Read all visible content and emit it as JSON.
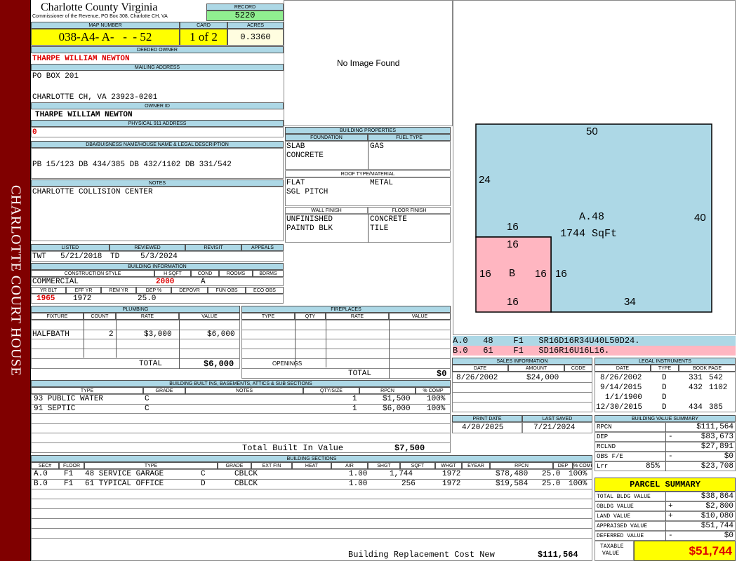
{
  "sidebar": {
    "title": "CHARLOTTE COURT HOUSE"
  },
  "header": {
    "county": "Charlotte County Virginia",
    "commissioner": "Commissioner of the Revenue, PO Box 308, Charlotte CH, VA",
    "record_label": "RECORD",
    "record": "5220",
    "map_label": "MAP NUMBER",
    "map_number": "038-A4- A-   -  - 52",
    "card_label": "CARD",
    "card": "1 of 2",
    "acres_label": "ACRES",
    "acres": "0.3360"
  },
  "owner": {
    "deeded_label": "DEEDED OWNER",
    "deeded": "THARPE WILLIAM NEWTON",
    "mailing_label": "MAILING ADDRESS",
    "mail1": "PO BOX 201",
    "mail2": "CHARLOTTE CH, VA 23923-0201",
    "owner_id_label": "OWNER ID",
    "owner_id": "THARPE WILLIAM NEWTON",
    "phys_label": "PHYSICAL 911 ADDRESS",
    "phys": "0",
    "dba_label": "DBA/BUISNESS NAME/HOUSE NAME & LEGAL DESCRIPTION",
    "dba": "PB 15/123 DB 434/385 DB 432/1102 DB 331/542",
    "notes_label": "NOTES",
    "notes": "CHARLOTTE COLLISION CENTER"
  },
  "image": {
    "text": "No Image Found"
  },
  "bldg_props": {
    "title": "BUILDING PROPERTIES",
    "foundation_label": "FOUNDATION",
    "fuel_label": "FUEL TYPE",
    "foundation1": "SLAB",
    "foundation2": "CONCRETE",
    "fuel": "GAS",
    "roof_label": "ROOF TYPE/MATERIAL",
    "roof1": "FLAT",
    "roof2": "SGL PITCH",
    "roof_mat": "METAL",
    "wall_label": "WALL FINISH",
    "floor_label": "FLOOR FINISH",
    "wall1": "UNFINISHED",
    "wall2": "PAINTD BLK",
    "floor1": "CONCRETE",
    "floor2": "TILE"
  },
  "listing": {
    "listed_label": "LISTED",
    "reviewed_label": "REVIEWED",
    "revisit_label": "REVISIT",
    "appeals_label": "APPEALS",
    "listed_by": "TWT",
    "listed_date": "5/21/2018",
    "reviewed_by": "TD",
    "reviewed_date": "5/3/2024"
  },
  "bldg_info": {
    "title": "BUILDING INFORMATION",
    "h_style": "CONSTRUCTION STYLE",
    "h_hsqft": "H SQFT",
    "h_cond": "COND",
    "h_rooms": "ROOMS",
    "h_bdrms": "BDRMS",
    "style": "COMMERCIAL",
    "hsqft": "2000",
    "cond": "A",
    "h_yrblt": "YR BLT",
    "h_effyr": "EFF YR",
    "h_remyr": "REM YR",
    "h_dep": "DEP %",
    "h_depovr": "DEPOVR",
    "h_funobs": "FUN OBS",
    "h_ecoobs": "ECO OBS",
    "yrblt": "1965",
    "effyr": "1972",
    "dep": "25.0"
  },
  "plumbing": {
    "title": "PLUMBING",
    "h_fixture": "FIXTURE",
    "h_count": "COUNT",
    "h_rate": "RATE",
    "h_value": "VALUE",
    "rows": [
      {
        "fixture": "HALFBATH",
        "count": "2",
        "rate": "$3,000",
        "value": "$6,000"
      }
    ],
    "total_label": "TOTAL",
    "total": "$6,000"
  },
  "fireplaces": {
    "title": "FIREPLACES",
    "h_type": "TYPE",
    "h_qty": "QTY",
    "h_rate": "RATE",
    "h_value": "VALUE",
    "openings_label": "OPENINGS",
    "total_label": "TOTAL",
    "total": "$0"
  },
  "builtins": {
    "title": "BUILDING BUILT INS, BASEMENTS, ATTICS & SUB SECTIONS",
    "h_type": "TYPE",
    "h_grade": "GRADE",
    "h_notes": "NOTES",
    "h_qty": "QTY/SIZE",
    "h_rpcn": "RPCN",
    "h_comp": "% COMP",
    "rows": [
      {
        "type": "93 PUBLIC WATER",
        "grade": "C",
        "qty": "1",
        "rpcn": "$1,500",
        "comp": "100%"
      },
      {
        "type": "91 SEPTIC",
        "grade": "C",
        "qty": "1",
        "rpcn": "$6,000",
        "comp": "100%"
      }
    ],
    "total_label": "Total Built In Value",
    "total": "$7,500"
  },
  "sections": {
    "title": "BUILDING SECTIONS",
    "headers": [
      "SEC#",
      "FLOOR",
      "TYPE",
      "GRADE",
      "EXT FIN",
      "HEAT",
      "AIR",
      "SHGT",
      "SQFT",
      "WHGT",
      "EYEAR",
      "RPCN",
      "DEP",
      "% COMP"
    ],
    "rows": [
      {
        "sec": "A.0",
        "floor": "F1",
        "type": "48 SERVICE GARAGE",
        "grade": "C",
        "ext": "CBLCK",
        "shgt": "1.00",
        "sqft": "1,744",
        "eyear": "1972",
        "rpcn": "$78,480",
        "dep": "25.0",
        "comp": "100%"
      },
      {
        "sec": "B.0",
        "floor": "F1",
        "type": "61 TYPICAL OFFICE",
        "grade": "D",
        "ext": "CBLCK",
        "shgt": "1.00",
        "sqft": "256",
        "eyear": "1972",
        "rpcn": "$19,584",
        "dep": "25.0",
        "comp": "100%"
      }
    ],
    "brcn_label": "Building Replacement Cost New",
    "brcn": "$111,564"
  },
  "sketch": {
    "dim_top": "50",
    "dim_left": "24",
    "dim_right": "40",
    "dim_bottom": "34",
    "a_label": "A.48",
    "a_sqft": "1744 SqFt",
    "b_top_out": "16",
    "b_top": "16",
    "b_left": "16",
    "b_right_in": "16",
    "b_right_out": "16",
    "b_bottom": "16",
    "b_label": "B",
    "color_a": "#add8e6",
    "color_b": "#ffb6c1",
    "line_a": "A.0   48    F1   SR16D16R34U40L50D24.",
    "line_b": "B.0   61    F1   SD16R16U16L16."
  },
  "sales": {
    "title": "SALES INFORMATION",
    "h_date": "DATE",
    "h_amount": "AMOUNT",
    "h_code": "CODE",
    "rows": [
      {
        "date": "8/26/2002",
        "amount": "$24,000",
        "code": ""
      }
    ]
  },
  "legal": {
    "title": "LEGAL INSTRUMENTS",
    "h_date": "DATE",
    "h_type": "TYPE",
    "h_book": "BOOK PAGE",
    "rows": [
      {
        "date": "8/26/2002",
        "type": "D",
        "book": "331",
        "page": "542"
      },
      {
        "date": "9/14/2015",
        "type": "D",
        "book": "432",
        "page": "1102"
      },
      {
        "date": "1/1/1900",
        "type": "D",
        "book": "",
        "page": ""
      },
      {
        "date": "12/30/2015",
        "type": "D",
        "book": "434",
        "page": "385"
      }
    ]
  },
  "print_info": {
    "print_label": "PRINT DATE",
    "saved_label": "LAST SAVED",
    "print_date": "4/20/2025",
    "saved_date": "7/21/2024"
  },
  "bvs": {
    "title": "BUILDING VALUE SUMMARY",
    "rows": [
      {
        "label": "RPCN",
        "pct": "",
        "sign": "",
        "value": "$111,564"
      },
      {
        "label": "DEP",
        "pct": "",
        "sign": "-",
        "value": "$83,673"
      },
      {
        "label": "RCLND",
        "pct": "",
        "sign": "",
        "value": "$27,891"
      },
      {
        "label": "OBS F/E",
        "pct": "",
        "sign": "-",
        "value": "$0"
      },
      {
        "label": "Lrr",
        "pct": "85%",
        "sign": "",
        "value": "$23,708"
      }
    ]
  },
  "parcel": {
    "title": "PARCEL SUMMARY",
    "rows": [
      {
        "label": "TOTAL BLDG VALUE",
        "sign": "",
        "value": "$38,864"
      },
      {
        "label": "OBLDG VALUE",
        "sign": "+",
        "value": "$2,800"
      },
      {
        "label": "LAND VALUE",
        "sign": "+",
        "value": "$10,080"
      },
      {
        "label": "APPRAISED VALUE",
        "sign": "",
        "value": "$51,744"
      },
      {
        "label": "DEFERRED VALUE",
        "sign": "-",
        "value": "$0"
      }
    ],
    "taxable_label1": "TAXABLE",
    "taxable_label2": "VALUE",
    "taxable": "$51,744"
  }
}
